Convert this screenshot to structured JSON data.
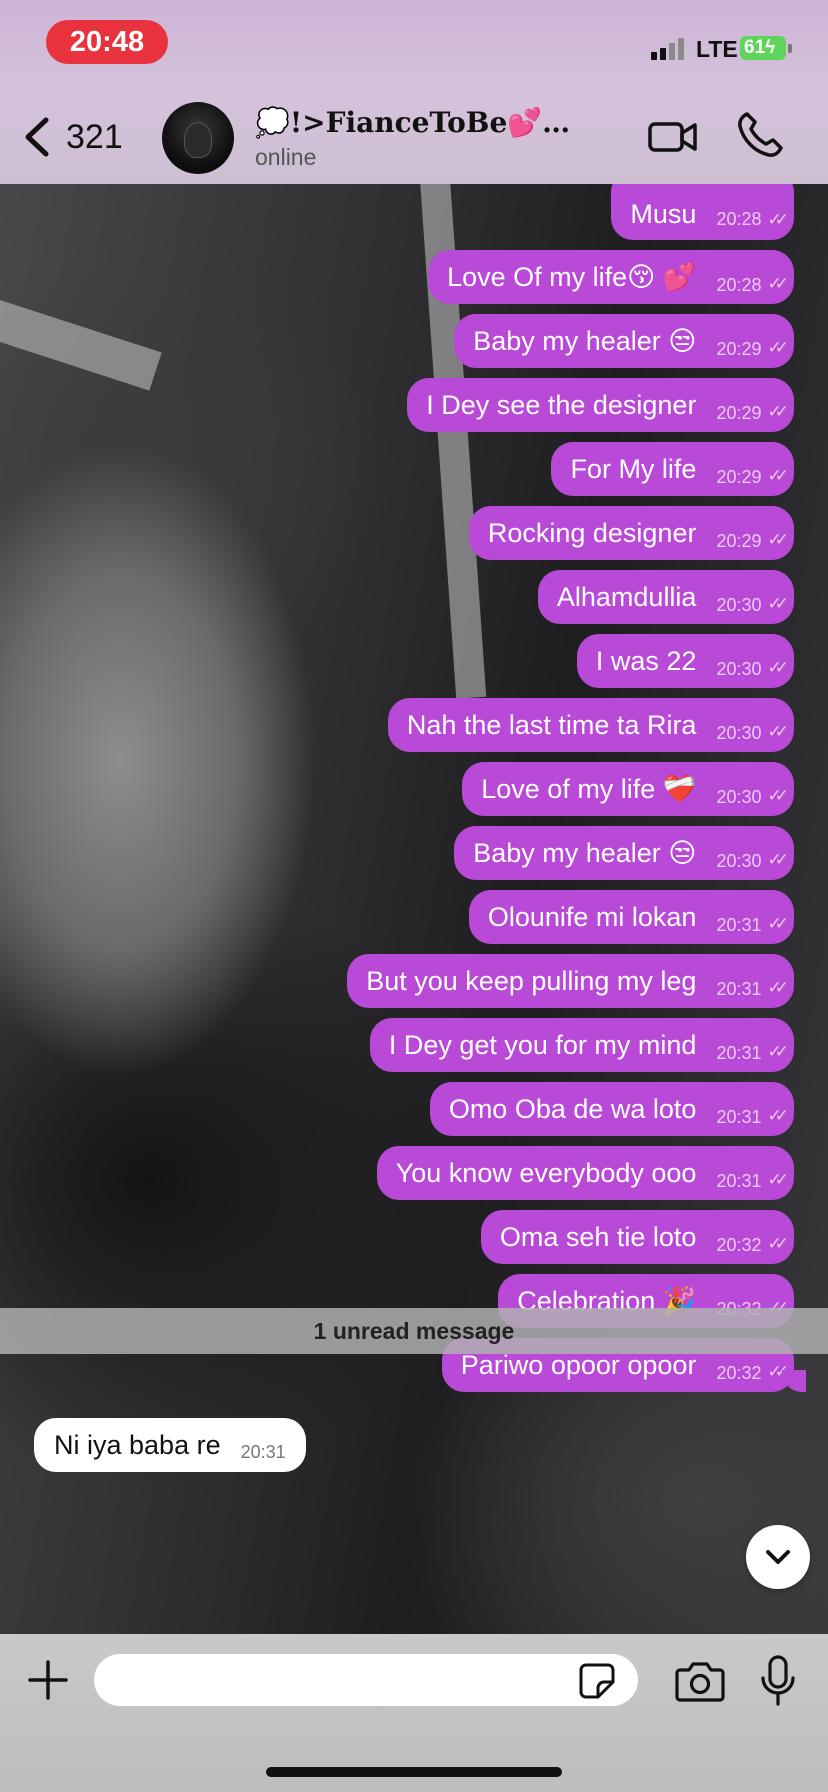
{
  "status_bar": {
    "time": "20:48",
    "network": "LTE",
    "battery": "61"
  },
  "header": {
    "back_count": "321",
    "contact_name": "💭!>FianceToBe💕 🫢 ...",
    "contact_status": "online"
  },
  "messages": [
    {
      "text": "Musu",
      "time": "20:28"
    },
    {
      "text": "Love Of my life😚 💕",
      "time": "20:28"
    },
    {
      "text": "Baby my healer 😒",
      "time": "20:29"
    },
    {
      "text": "I Dey see the designer",
      "time": "20:29"
    },
    {
      "text": "For My life",
      "time": "20:29"
    },
    {
      "text": "Rocking designer",
      "time": "20:29"
    },
    {
      "text": "Alhamdullia",
      "time": "20:30"
    },
    {
      "text": "I was 22",
      "time": "20:30"
    },
    {
      "text": "Nah the last time ta Rira",
      "time": "20:30"
    },
    {
      "text": "Love of my life ❤️‍🩹",
      "time": "20:30"
    },
    {
      "text": "Baby my healer 😒",
      "time": "20:30"
    },
    {
      "text": "Olounife mi lokan",
      "time": "20:31"
    },
    {
      "text": "But you keep pulling my leg",
      "time": "20:31"
    },
    {
      "text": "I Dey get you for my mind",
      "time": "20:31"
    },
    {
      "text": "Omo Oba de wa loto",
      "time": "20:31"
    },
    {
      "text": "You know everybody ooo",
      "time": "20:31"
    },
    {
      "text": "Oma seh tie loto",
      "time": "20:32"
    },
    {
      "text": "Celebration 🎉",
      "time": "20:32"
    },
    {
      "text": "Pariwo opoor opoor",
      "time": "20:32"
    }
  ],
  "incoming": {
    "text": "Ni iya baba re",
    "time": "20:31"
  },
  "unread_label": "1 unread message",
  "composer": {
    "value": "",
    "placeholder": ""
  },
  "colors": {
    "bubble_out": "#b94ad7",
    "bubble_in": "#ffffff",
    "time_pill": "#e8333f",
    "battery": "#5fd45a"
  },
  "icons": [
    "back-chevron-icon",
    "video-call-icon",
    "phone-icon",
    "chevron-down-icon",
    "plus-icon",
    "sticker-icon",
    "camera-icon",
    "microphone-icon",
    "double-check-icon"
  ]
}
